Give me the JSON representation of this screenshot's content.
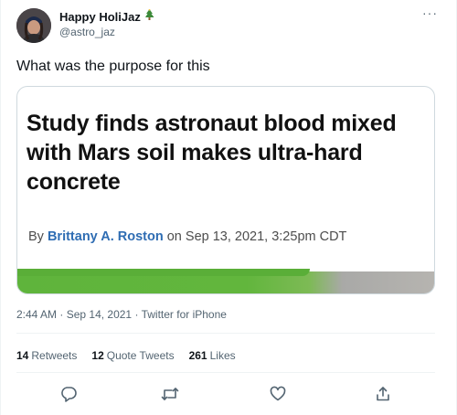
{
  "user": {
    "display_name": "Happy HoliJaz",
    "badge_icon": "christmas-tree-icon",
    "handle": "@astro_jaz"
  },
  "menu_icon": "more-icon",
  "tweet": {
    "text": "What was the purpose for this"
  },
  "card": {
    "headline": "Study finds astronaut blood mixed with Mars soil makes ultra-hard concrete",
    "byline_prefix": "By",
    "author": "Brittany A. Roston",
    "byline_suffix": "on Sep 13, 2021, 3:25pm CDT"
  },
  "meta": {
    "time": "2:44 AM",
    "separator1": " · ",
    "date": "Sep 14, 2021",
    "separator2": " · ",
    "source": "Twitter for iPhone"
  },
  "stats": [
    {
      "count": "14",
      "label": "Retweets"
    },
    {
      "count": "12",
      "label": "Quote Tweets"
    },
    {
      "count": "261",
      "label": "Likes"
    }
  ],
  "actions": [
    "reply-icon",
    "retweet-icon",
    "like-icon",
    "share-icon"
  ],
  "colors": {
    "text": "#0f1419",
    "secondary": "#536471",
    "author_link": "#2f6db3",
    "border": "#cfd9de"
  }
}
